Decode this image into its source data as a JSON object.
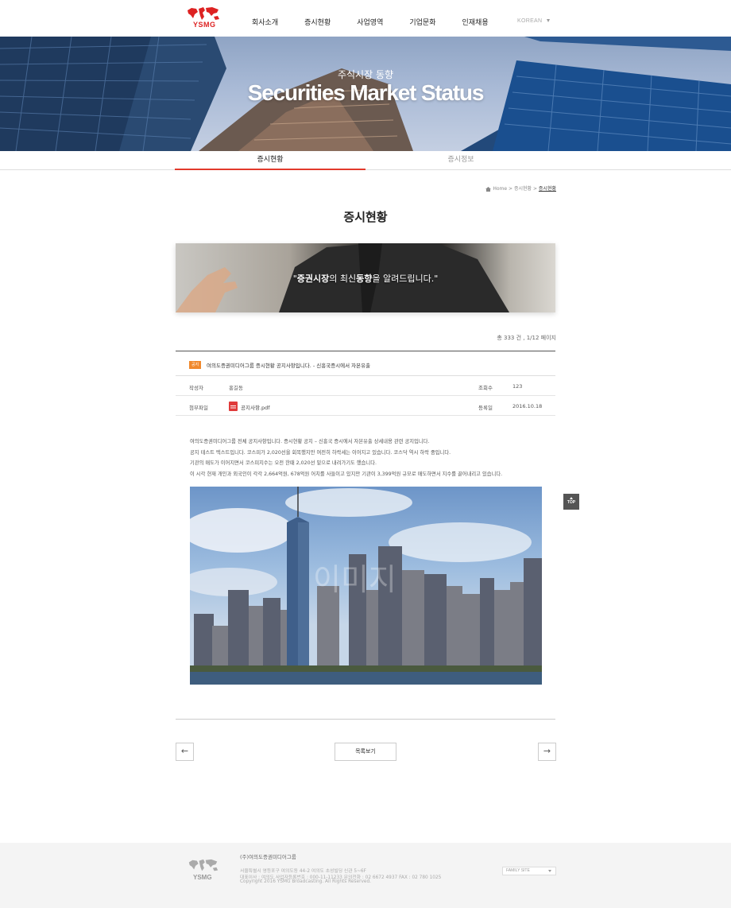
{
  "header": {
    "logo_text": "YSMG",
    "nav": [
      "회사소개",
      "증시현황",
      "사업영역",
      "기업문화",
      "인재채용"
    ],
    "language": "KOREAN"
  },
  "hero": {
    "subtitle": "주식시장 동향",
    "title": "Securities Market Status"
  },
  "subtabs": [
    "증시현황",
    "증시정보"
  ],
  "breadcrumb": {
    "home": "Home",
    "sep1": ">",
    "level1": "증시현황",
    "sep2": ">",
    "current": "증시현황"
  },
  "page_title": "증시현황",
  "banner": {
    "quote_open": "\"",
    "bold1": "증권시장",
    "mid": "의 최신",
    "bold2": "동향",
    "tail": "을 알려드립니다.\""
  },
  "count_text": "총 333 건 ,  1/12 페이지",
  "post": {
    "badge": "공지",
    "title": "여의도증권미디어그룹 증시현황 공지사항입니다. -  신흥국증시에서 자본유출",
    "author_label": "작성자",
    "author": "홍길동",
    "views_label": "조회수",
    "views": "123",
    "attach_label": "첨부파일",
    "attach_file": "공지사항.pdf",
    "date_label": "등록일",
    "date": "2016.10.18",
    "body": [
      "여의도증권미디어그룹 전체 공지사항입니다. 증시현황 공지 – 신흥국 증시에서 자본유출 상세내용 관련 공지입니다.",
      "공지 테스트 텍스트입니다. 코스피가 2,020선을 회복했지만 여전히 하락세는 이어지고 있습니다. 코스닥 역시 하락 중입니다.",
      "기관의 매도가 이어지면서 코스피지수는 오전 한때 2,020선 밑으로 내려가기도 했습니다.",
      "이 시각 현재 개인과 외국인이 각각 2,664억원, 678억원 어치를 사들이고 있지만 기관이 3,399억원 규모로 매도하면서 지수를 끌어내리고 있습니다."
    ],
    "image_watermark": "이미지"
  },
  "top_button": "TOP",
  "prev_icon": "←",
  "next_icon": "→",
  "list_button": "목록보기",
  "footer": {
    "logo_text": "YSMG",
    "company": "(주)여의도증권미디어그룹",
    "address": "서울특별시 영등포구 여의도동 44-2 여의도 초성빌딩 신관 5~6F",
    "info": "대표이사 : 여의도    사업자등록번호 : 000-11-11233      문의전화 : 02 6672 4937      FAX : 02 780 1025",
    "copyright": "Copyright 2016 YSMG Broadcasting. All Rights Reserved.",
    "family_site": "FAMILY SITE"
  },
  "colors": {
    "accent": "#e23a2c",
    "badge": "#f0892d",
    "logo": "#d22"
  }
}
